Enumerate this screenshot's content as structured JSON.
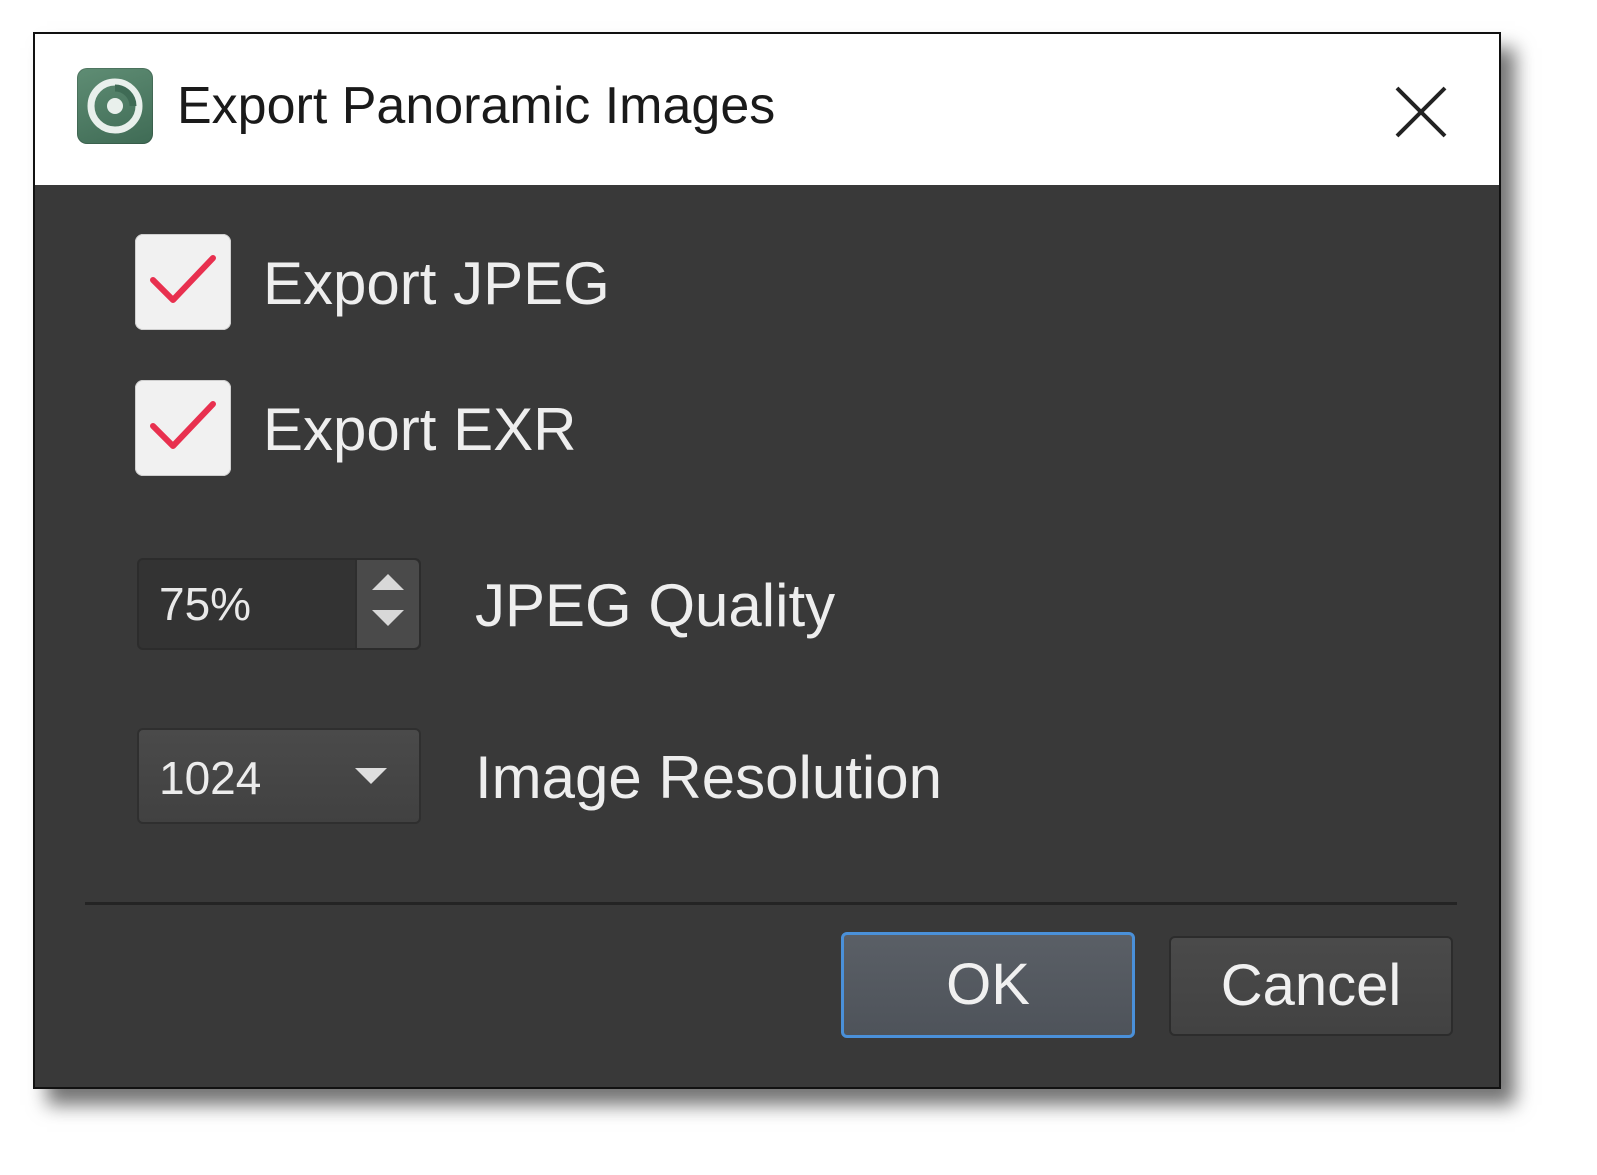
{
  "window": {
    "title": "Export Panoramic Images",
    "icons": {
      "app": "app-logo-icon",
      "close": "close-icon"
    }
  },
  "options": {
    "export_jpeg": {
      "label": "Export JPEG",
      "checked": true
    },
    "export_exr": {
      "label": "Export EXR",
      "checked": true
    }
  },
  "jpeg_quality": {
    "value": "75%",
    "label": "JPEG Quality"
  },
  "image_resolution": {
    "selected": "1024",
    "label": "Image Resolution"
  },
  "buttons": {
    "ok": "OK",
    "cancel": "Cancel"
  },
  "colors": {
    "check_mark": "#e8304f",
    "focus_border": "#4a90d9",
    "dialog_bg": "#393939",
    "titlebar_bg": "#ffffff"
  }
}
